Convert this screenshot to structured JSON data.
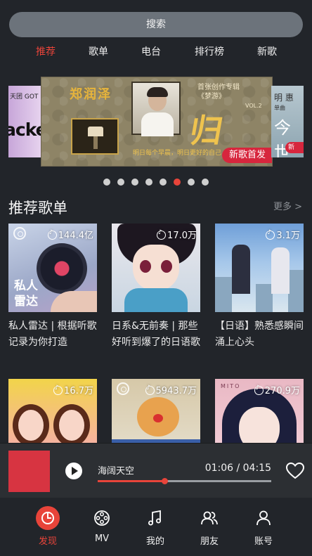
{
  "search": {
    "label": "搜索"
  },
  "tabs": [
    {
      "label": "推荐",
      "active": true
    },
    {
      "label": "歌单"
    },
    {
      "label": "电台"
    },
    {
      "label": "排行榜"
    },
    {
      "label": "新歌"
    }
  ],
  "banner": {
    "left_top": "天团 GOT",
    "left_text": "acker",
    "main_artist": "郑润泽",
    "main_album_line1": "首张创作专辑",
    "main_album_line2": "《梦游》",
    "main_vol": "VOL.2",
    "main_title": "归",
    "main_slogan": "明日每个早晨，明日更好的自己",
    "main_badge": "新歌首发",
    "right_top": "明 惠",
    "right_sub": "单曲",
    "right_text": "今世",
    "right_badge": "新",
    "dot_count": 8,
    "active_dot": 5
  },
  "section": {
    "title": "推荐歌单",
    "more": "更多 >"
  },
  "playlists": [
    {
      "plays": "144.4亿",
      "name": "私人雷达 | 根据听歌记录为你打造",
      "cover_label": "私人\n雷达"
    },
    {
      "plays": "17.0万",
      "name": "日系&无前奏 | 那些好听到爆了的日语歌"
    },
    {
      "plays": "3.1万",
      "name": "【日语】熟悉感瞬间涌上心头"
    },
    {
      "plays": "16.7万",
      "name": ""
    },
    {
      "plays": "5943.7万",
      "name": ""
    },
    {
      "plays": "270.9万",
      "name": "",
      "cover_text": "MITO"
    }
  ],
  "player": {
    "song": "海阔天空",
    "time": "01:06 / 04:15",
    "progress": 0.385,
    "accent": "#e8443a",
    "art_color": "#d73441"
  },
  "nav": [
    {
      "label": "发现",
      "icon": "discover-icon",
      "active": true
    },
    {
      "label": "MV",
      "icon": "mv-icon"
    },
    {
      "label": "我的",
      "icon": "music-note-icon"
    },
    {
      "label": "朋友",
      "icon": "friends-icon"
    },
    {
      "label": "账号",
      "icon": "account-icon"
    }
  ]
}
